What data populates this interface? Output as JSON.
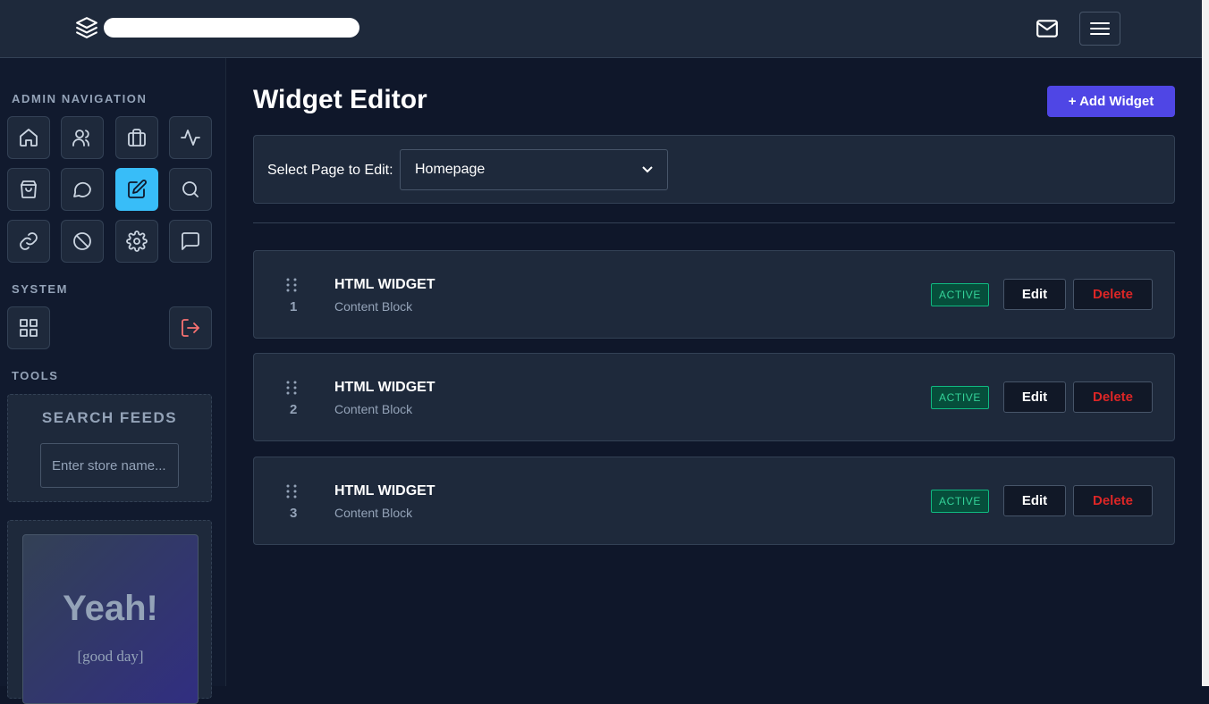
{
  "header": {
    "brand_name": "",
    "icons": {
      "brand": "layers-icon",
      "mail": "mail-icon",
      "menu": "hamburger-menu-icon"
    }
  },
  "sidebar": {
    "admin_nav_title": "ADMIN NAVIGATION",
    "admin_nav_items": [
      {
        "icon": "home-icon"
      },
      {
        "icon": "users-icon"
      },
      {
        "icon": "briefcase-icon"
      },
      {
        "icon": "activity-icon"
      },
      {
        "icon": "shopping-bag-icon"
      },
      {
        "icon": "message-circle-icon"
      },
      {
        "icon": "edit-icon",
        "active": true
      },
      {
        "icon": "search-icon"
      },
      {
        "icon": "link-icon"
      },
      {
        "icon": "ban-icon"
      },
      {
        "icon": "settings-icon"
      },
      {
        "icon": "message-square-icon"
      }
    ],
    "system_title": "SYSTEM",
    "system_items": [
      {
        "icon": "grid-icon"
      },
      {
        "icon": "logout-icon"
      }
    ],
    "tools_title": "TOOLS",
    "search_feeds": {
      "title": "SEARCH FEEDS",
      "placeholder": "Enter store name..."
    },
    "promo": {
      "title": "Yeah!",
      "subtitle": "[good day]"
    }
  },
  "main": {
    "title": "Widget Editor",
    "add_button": "+ Add Widget",
    "select_label": "Select Page to Edit:",
    "select_value": "Homepage",
    "widgets": [
      {
        "order": "1",
        "title": "HTML WIDGET",
        "subtitle": "Content Block",
        "status": "ACTIVE",
        "edit_label": "Edit",
        "delete_label": "Delete"
      },
      {
        "order": "2",
        "title": "HTML WIDGET",
        "subtitle": "Content Block",
        "status": "ACTIVE",
        "edit_label": "Edit",
        "delete_label": "Delete"
      },
      {
        "order": "3",
        "title": "HTML WIDGET",
        "subtitle": "Content Block",
        "status": "ACTIVE",
        "edit_label": "Edit",
        "delete_label": "Delete"
      }
    ]
  },
  "colors": {
    "accent": "#4f46e5",
    "active_nav": "#38bdf8",
    "status_active": "#34d399",
    "danger": "#dc2626"
  }
}
